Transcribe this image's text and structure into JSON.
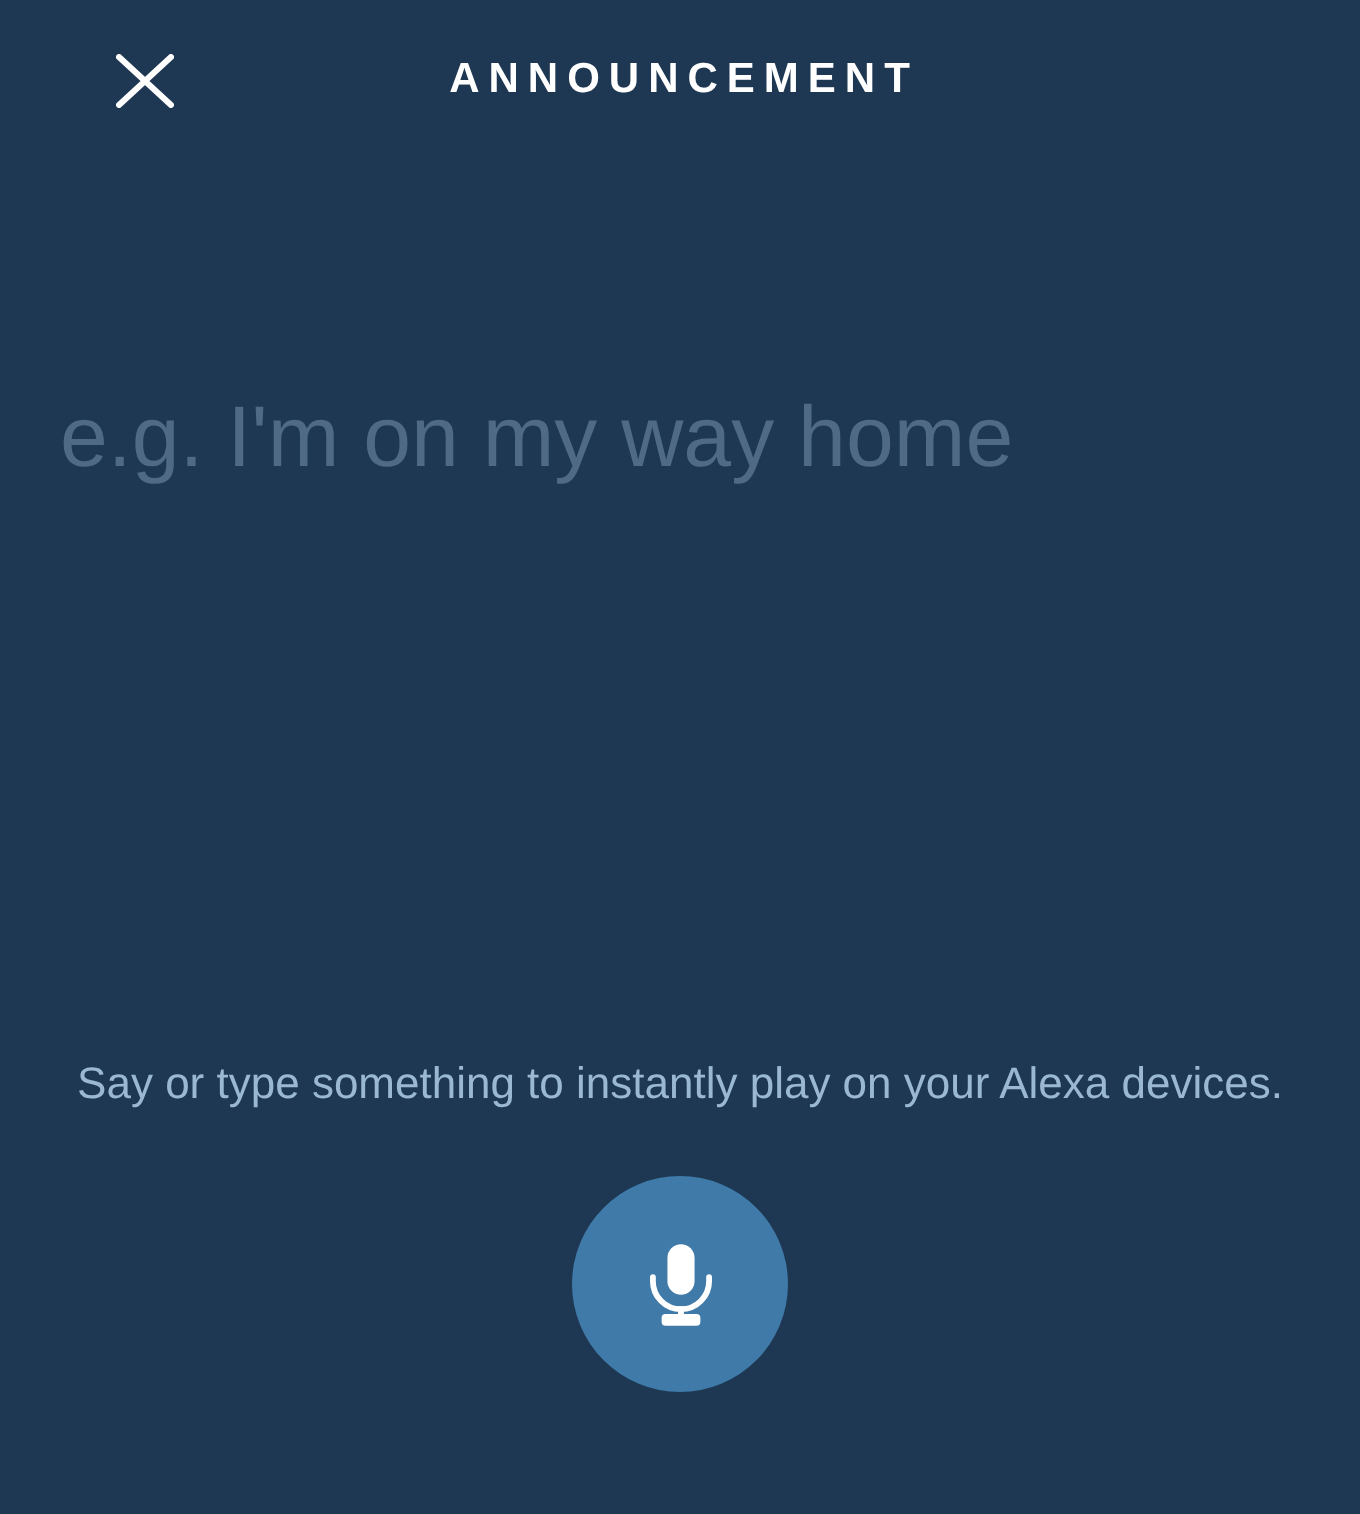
{
  "header": {
    "title": "ANNOUNCEMENT"
  },
  "message": {
    "placeholder": "e.g. I'm on my way home"
  },
  "hint": "Say or type something to instantly play on your Alexa devices."
}
